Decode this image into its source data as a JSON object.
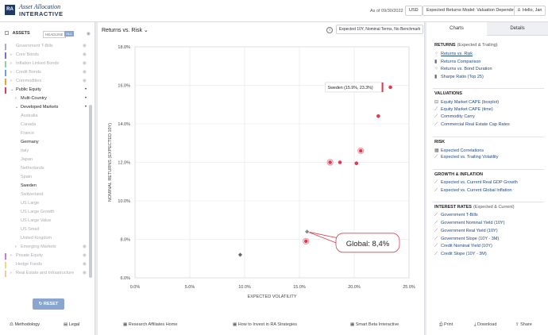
{
  "header": {
    "logo_mark": "RA",
    "logo_line1": "Asset Allocation",
    "logo_line2": "INTERACTIVE",
    "as_of": "As of 09/30/2022",
    "currency": "USD",
    "model": "Expected Returns Model: Valuation Dependent",
    "user": "Hello, Jan"
  },
  "sidebar": {
    "assets_label": "ASSETS",
    "toggle_headline": "HEADLINE",
    "toggle_all": "ALL",
    "items": [
      {
        "label": "Government T-Bills",
        "color": "#b6a1d6",
        "chev": "",
        "level": 0,
        "dim": true
      },
      {
        "label": "Core Bonds",
        "color": "#7a6fd1",
        "chev": "›",
        "level": 0,
        "dim": true
      },
      {
        "label": "Inflation Linked Bonds",
        "color": "#8fd3a2",
        "chev": "›",
        "level": 0,
        "dim": true
      },
      {
        "label": "Credit Bonds",
        "color": "#6aa0e0",
        "chev": "›",
        "level": 0,
        "dim": true
      },
      {
        "label": "Commodities",
        "color": "#f2a03d",
        "chev": "›",
        "level": 0,
        "dim": true
      },
      {
        "label": "Public Equity",
        "color": "#e03b52",
        "chev": "⌄",
        "level": 0,
        "dim": false
      },
      {
        "label": "Multi-Country",
        "color": "",
        "chev": "›",
        "level": 1,
        "dim": false
      },
      {
        "label": "Developed Markets",
        "color": "",
        "chev": "⌄",
        "level": 1,
        "dim": false
      },
      {
        "label": "Australia",
        "color": "",
        "chev": "",
        "level": 2,
        "dim": true
      },
      {
        "label": "Canada",
        "color": "",
        "chev": "",
        "level": 2,
        "dim": true
      },
      {
        "label": "France",
        "color": "",
        "chev": "",
        "level": 2,
        "dim": true
      },
      {
        "label": "Germany",
        "color": "",
        "chev": "",
        "level": 2,
        "dim": false
      },
      {
        "label": "Italy",
        "color": "",
        "chev": "",
        "level": 2,
        "dim": true
      },
      {
        "label": "Japan",
        "color": "",
        "chev": "",
        "level": 2,
        "dim": true
      },
      {
        "label": "Netherlands",
        "color": "",
        "chev": "",
        "level": 2,
        "dim": true
      },
      {
        "label": "Spain",
        "color": "",
        "chev": "",
        "level": 2,
        "dim": true
      },
      {
        "label": "Sweden",
        "color": "",
        "chev": "",
        "level": 2,
        "dim": false
      },
      {
        "label": "Switzerland",
        "color": "",
        "chev": "",
        "level": 2,
        "dim": true
      },
      {
        "label": "US Large",
        "color": "",
        "chev": "",
        "level": 2,
        "dim": true
      },
      {
        "label": "US Large Growth",
        "color": "",
        "chev": "",
        "level": 2,
        "dim": true
      },
      {
        "label": "US Large Value",
        "color": "",
        "chev": "",
        "level": 2,
        "dim": true
      },
      {
        "label": "US Small",
        "color": "",
        "chev": "",
        "level": 2,
        "dim": true
      },
      {
        "label": "United Kingdom",
        "color": "",
        "chev": "",
        "level": 2,
        "dim": true
      },
      {
        "label": "Emerging Markets",
        "color": "",
        "chev": "›",
        "level": 1,
        "dim": true
      },
      {
        "label": "Private Equity",
        "color": "#c77ad8",
        "chev": "›",
        "level": 0,
        "dim": true
      },
      {
        "label": "Hedge Funds",
        "color": "#e3e07a",
        "chev": "",
        "level": 0,
        "dim": true
      },
      {
        "label": "Real Estate and Infrastructure",
        "color": "#f4c99a",
        "chev": "›",
        "level": 0,
        "dim": true
      }
    ],
    "reset_label": "RESET",
    "methodology_label": "Methodology",
    "legal_label": "Legal"
  },
  "main": {
    "chart_title": "Returns vs. Risk",
    "benchmark": "Expected 10Y, Nominal Terms, No Benchmark",
    "footer_links": [
      "Research Affiliates Home",
      "How to Invest in RA Strategies",
      "Smart Beta Interactive"
    ]
  },
  "chart_data": {
    "type": "scatter",
    "xlabel": "EXPECTED VOLATILITY",
    "ylabel": "NOMINAL RETURNS (EXPECTED 10Y)",
    "xlim": [
      0,
      25
    ],
    "ylim": [
      6,
      18
    ],
    "xticks": [
      0,
      5,
      10,
      15,
      20,
      25
    ],
    "xtick_labels": [
      "0.0%",
      "5.0%",
      "10.0%",
      "15.0%",
      "20.0%",
      "25.0%"
    ],
    "yticks": [
      6,
      8,
      10,
      12,
      14,
      16,
      18
    ],
    "ytick_labels": [
      "6.0%",
      "8.0%",
      "10.0%",
      "12.0%",
      "14.0%",
      "16.0%",
      "18.0%"
    ],
    "points": [
      {
        "x": 23.3,
        "y": 15.9,
        "color": "#e03b52",
        "marker": "circle",
        "ring": false
      },
      {
        "x": 22.2,
        "y": 14.4,
        "color": "#e03b52",
        "marker": "circle",
        "ring": false
      },
      {
        "x": 20.6,
        "y": 12.6,
        "color": "#e03b52",
        "marker": "circle",
        "ring": true
      },
      {
        "x": 17.8,
        "y": 12.0,
        "color": "#e03b52",
        "marker": "circle",
        "ring": true
      },
      {
        "x": 18.7,
        "y": 12.0,
        "color": "#e03b52",
        "marker": "circle",
        "ring": false
      },
      {
        "x": 20.2,
        "y": 11.95,
        "color": "#e03b52",
        "marker": "circle",
        "ring": false
      },
      {
        "x": 15.6,
        "y": 7.9,
        "color": "#e03b52",
        "marker": "circle",
        "ring": true
      },
      {
        "x": 15.7,
        "y": 8.4,
        "color": "#888888",
        "marker": "diamond",
        "ring": false
      },
      {
        "x": 9.6,
        "y": 7.2,
        "color": "#666666",
        "marker": "diamond",
        "ring": false
      }
    ],
    "tooltip": {
      "text": "Sweden (15.9%, 23.3%)",
      "x": 23.3,
      "y": 15.9
    },
    "callout": {
      "text": "Global: 8,4%",
      "x": 15.7,
      "y": 8.4
    }
  },
  "right_panel": {
    "tabs": [
      "Charts",
      "Details"
    ],
    "sections": [
      {
        "title": "RETURNS",
        "sub": "(Expected & Trailing)",
        "items": [
          {
            "label": "Returns vs. Risk",
            "icon": "scatter-icon",
            "active": true
          },
          {
            "label": "Returns Comparison",
            "icon": "bars-icon",
            "active": false
          },
          {
            "label": "Returns vs. Bond Duration",
            "icon": "scatter-icon",
            "active": false
          },
          {
            "label": "Sharpe Ratio (Top 25)",
            "icon": "bars-icon",
            "active": false
          }
        ]
      },
      {
        "title": "VALUATIONS",
        "sub": "",
        "items": [
          {
            "label": "Equity Market CAPE (boxplot)",
            "icon": "boxplot-icon",
            "active": false
          },
          {
            "label": "Equity Market CAPE (time)",
            "icon": "line-icon",
            "active": false
          },
          {
            "label": "Commodity Carry",
            "icon": "line-icon",
            "active": false
          },
          {
            "label": "Commercial Real Estate Cap Rates",
            "icon": "line-icon",
            "active": false
          }
        ]
      },
      {
        "title": "RISK",
        "sub": "",
        "items": [
          {
            "label": "Expected Correlations",
            "icon": "grid-icon",
            "active": false
          },
          {
            "label": "Expected vs. Trailing Volatility",
            "icon": "line-icon",
            "active": false
          }
        ]
      },
      {
        "title": "GROWTH & INFLATION",
        "sub": "",
        "items": [
          {
            "label": "Expected vs. Current Real GDP Growth",
            "icon": "line-icon",
            "active": false
          },
          {
            "label": "Expected vs. Current Global Inflation",
            "icon": "line-icon",
            "active": false
          }
        ]
      },
      {
        "title": "INTEREST RATES",
        "sub": "(Expected & Current)",
        "items": [
          {
            "label": "Government T-Bills",
            "icon": "line-icon",
            "active": false
          },
          {
            "label": "Government Nominal Yield (10Y)",
            "icon": "line-icon",
            "active": false
          },
          {
            "label": "Government Real Yield (10Y)",
            "icon": "line-icon",
            "active": false
          },
          {
            "label": "Government Slope (10Y - 3M)",
            "icon": "line-icon",
            "active": false
          },
          {
            "label": "Credit Nominal Yield (10Y)",
            "icon": "line-icon",
            "active": false
          },
          {
            "label": "Credit Slope (10Y - 3M)",
            "icon": "line-icon",
            "active": false
          }
        ]
      }
    ],
    "footer": [
      "Print",
      "Download",
      "Share"
    ]
  }
}
